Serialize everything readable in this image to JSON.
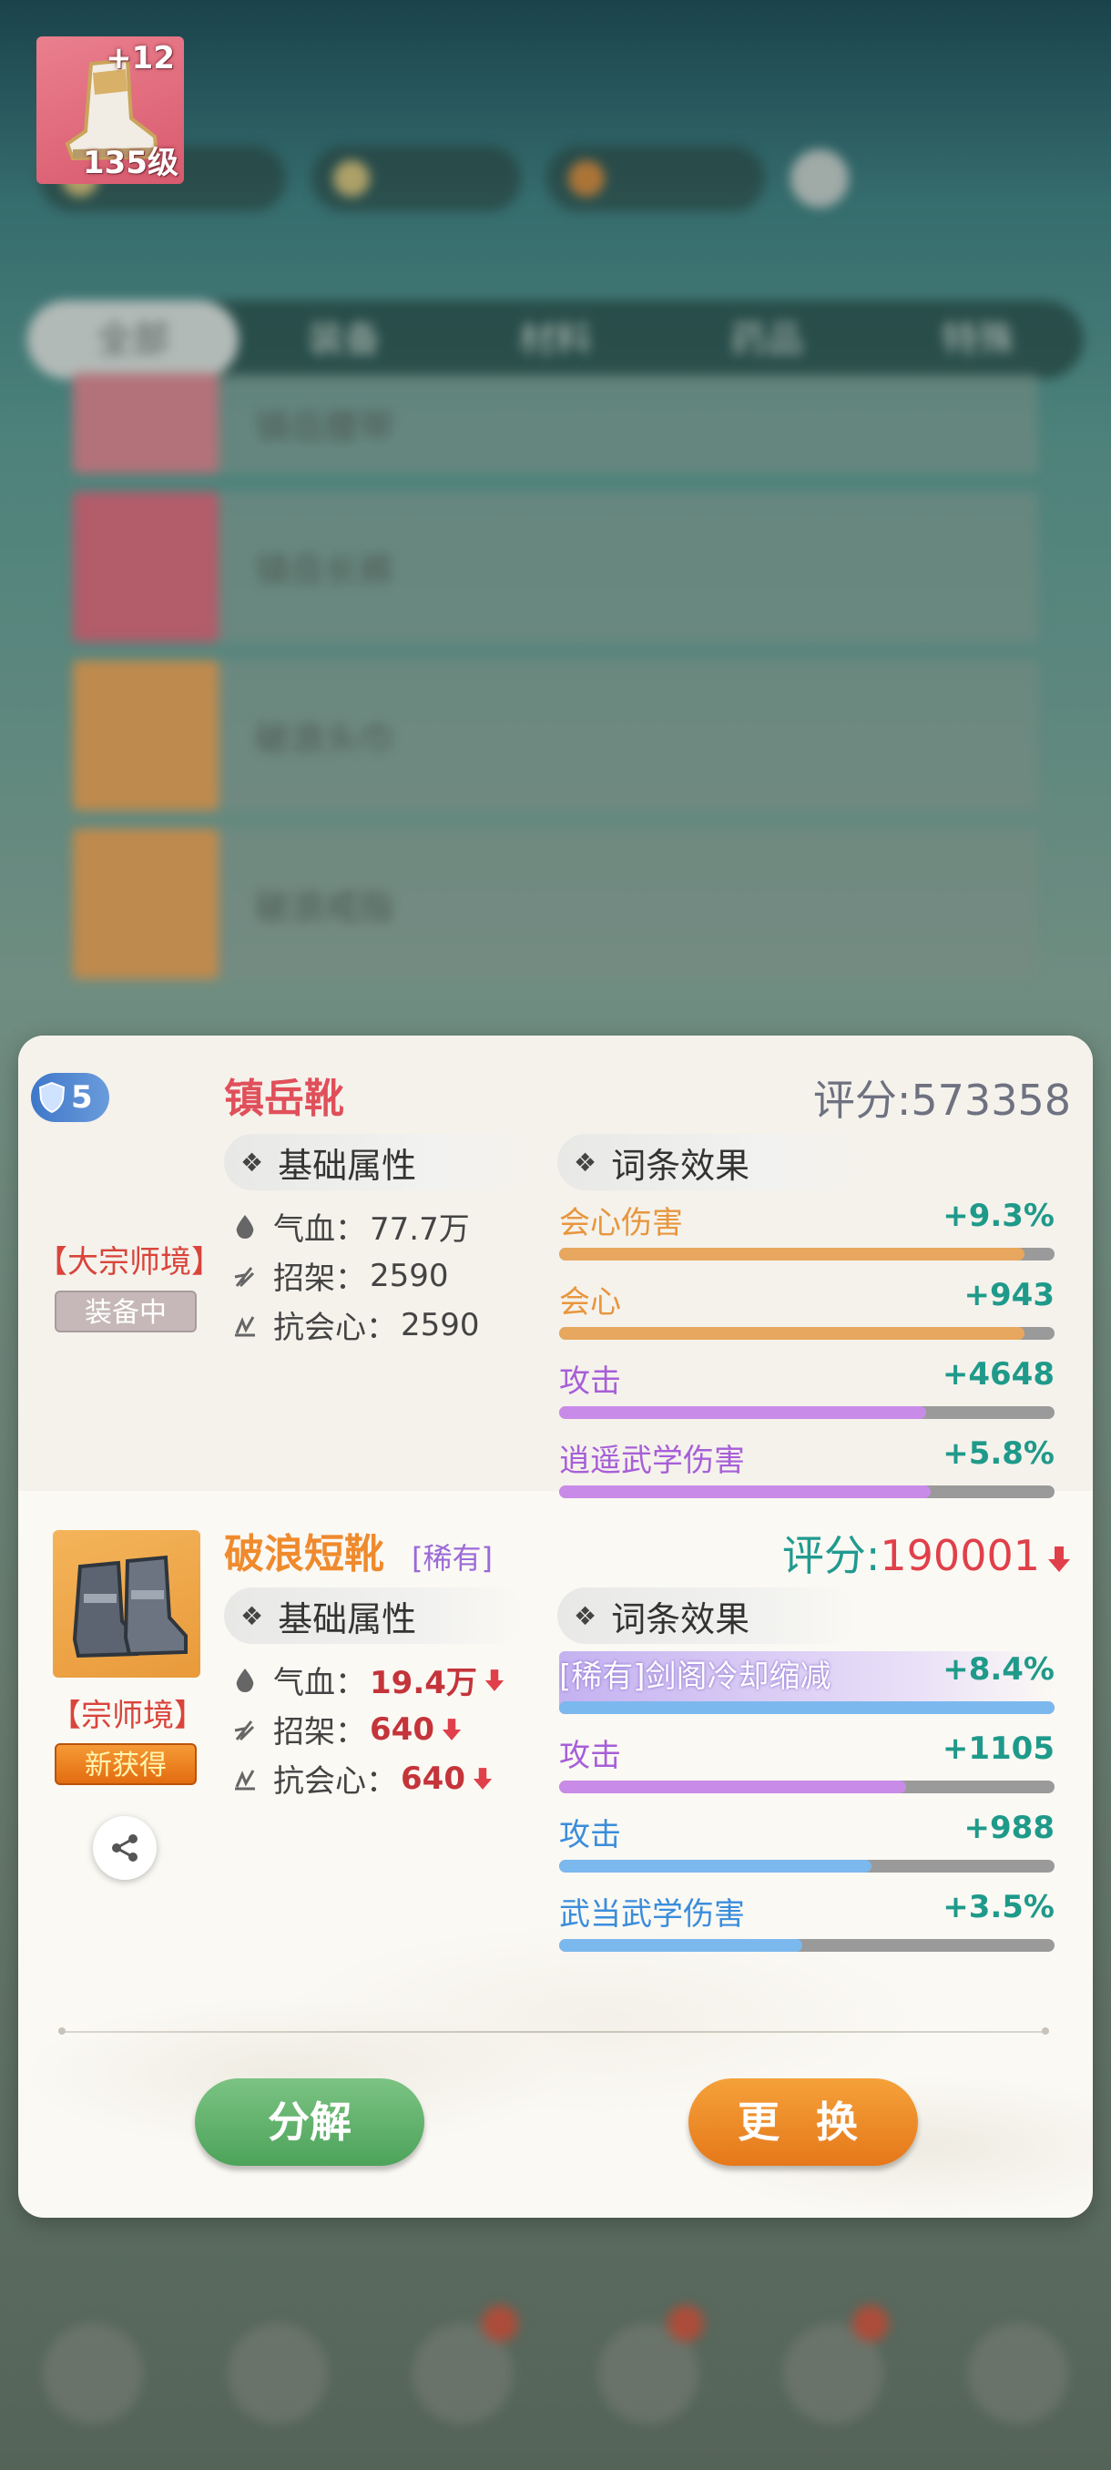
{
  "background": {
    "tabs": [
      "全部",
      "装备",
      "材料",
      "药品",
      "特殊"
    ],
    "inventory_items": [
      {
        "name": "镇岳腰带",
        "color": "#e08791"
      },
      {
        "name": "镇岳长裤",
        "color": "#e06b7d"
      },
      {
        "name": "破浪头巾",
        "color": "#f0a658"
      },
      {
        "name": "破浪戒指",
        "color": "#f0a658"
      }
    ]
  },
  "equipped": {
    "name": "镇岳靴",
    "star": "5",
    "enhance": "+12",
    "level": "135级",
    "realm": "【大宗师境】",
    "status": "装备中",
    "score_label": "评分:573358",
    "base_header": "基础属性",
    "affix_header": "词条效果",
    "stats": [
      {
        "label": "气血：",
        "value": "77.7万"
      },
      {
        "label": "招架：",
        "value": "2590"
      },
      {
        "label": "抗会心：",
        "value": "2590"
      }
    ],
    "affixes": [
      {
        "label": "会心伤害",
        "value": "+9.3%",
        "fill": 0.94,
        "color": "#e8a75e",
        "label_color": "#e8963d"
      },
      {
        "label": "会心",
        "value": "+943",
        "fill": 0.94,
        "color": "#e8a75e",
        "label_color": "#e8963d"
      },
      {
        "label": "攻击",
        "value": "+4648",
        "fill": 0.74,
        "color": "#c98be8",
        "label_color": "#a75fd8"
      },
      {
        "label": "逍遥武学伤害",
        "value": "+5.8%",
        "fill": 0.75,
        "color": "#c98be8",
        "label_color": "#a75fd8"
      }
    ]
  },
  "new_item": {
    "name": "破浪短靴",
    "rarity": "[稀有]",
    "realm": "【宗师境】",
    "status": "新获得",
    "score_prefix": "评分:",
    "score_value": "190001",
    "base_header": "基础属性",
    "affix_header": "词条效果",
    "stats": [
      {
        "label": "气血：",
        "value": "19.4万"
      },
      {
        "label": "招架：",
        "value": "640"
      },
      {
        "label": "抗会心：",
        "value": "640"
      }
    ],
    "affixes": [
      {
        "label": "[稀有]剑阁冷却缩减",
        "value": "+8.4%",
        "fill": 1.0,
        "color": "#7bb8ee",
        "label_color": "#ffffff"
      },
      {
        "label": "攻击",
        "value": "+1105",
        "fill": 0.7,
        "color": "#c98be8",
        "label_color": "#a75fd8"
      },
      {
        "label": "攻击",
        "value": "+988",
        "fill": 0.63,
        "color": "#7bb8ee",
        "label_color": "#3a8ddc"
      },
      {
        "label": "武当武学伤害",
        "value": "+3.5%",
        "fill": 0.49,
        "color": "#7bb8ee",
        "label_color": "#3a8ddc"
      }
    ]
  },
  "buttons": {
    "disassemble": "分解",
    "replace": "更 换"
  }
}
